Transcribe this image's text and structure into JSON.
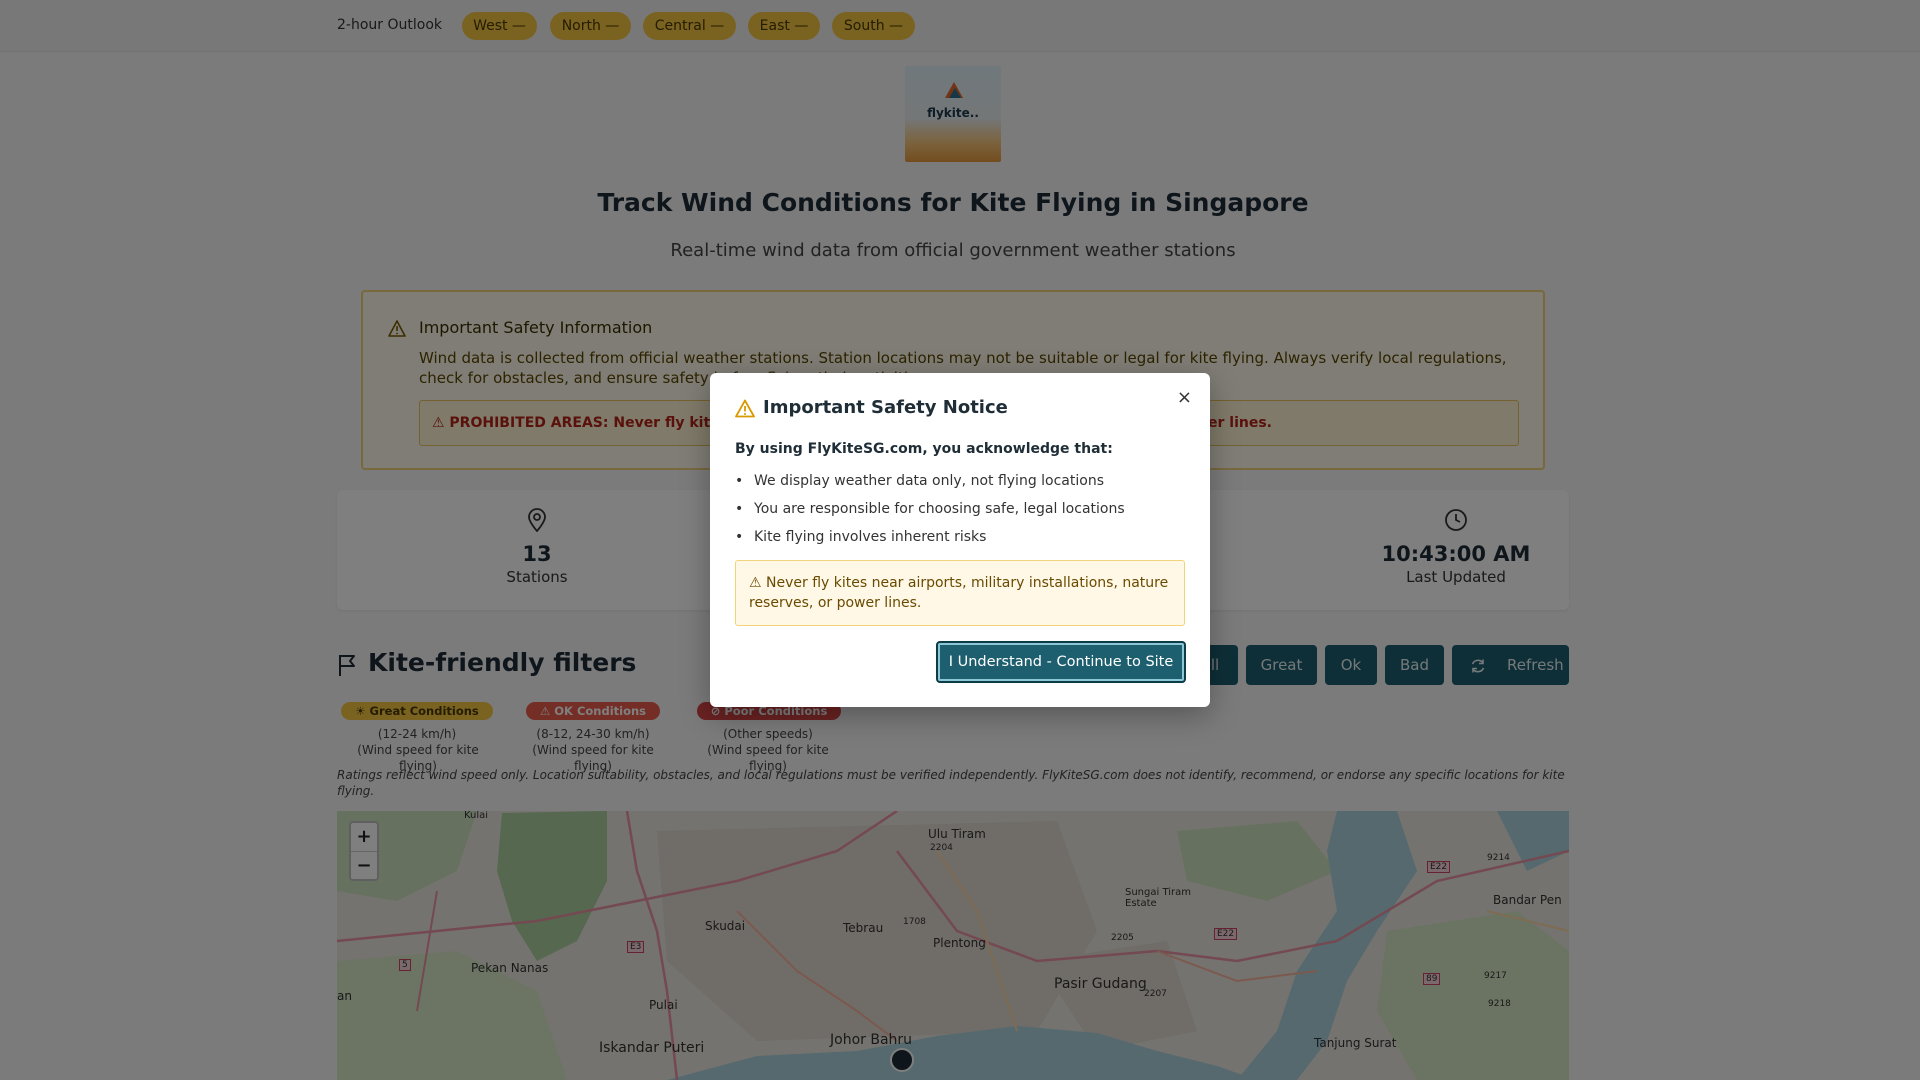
{
  "outlook": {
    "label": "2-hour Outlook",
    "regions": [
      "West —",
      "North —",
      "Central —",
      "East —",
      "South —"
    ]
  },
  "logo": {
    "brand": "flykite.."
  },
  "hero": {
    "title": "Track Wind Conditions for Kite Flying in Singapore",
    "subtitle": "Real-time wind data from official government weather stations"
  },
  "safety_info": {
    "title": "Important Safety Information",
    "body": "Wind data is collected from official weather stations. Station locations may not be suitable or legal for kite flying. Always verify local regulations, check for obstacles, and ensure safety before flying.",
    "body_tail": "their activities.",
    "prohibited": "⚠ PROHIBITED AREAS: Never fly kit",
    "prohibited_tail": "er lines."
  },
  "stats": {
    "stations": {
      "value": "13",
      "caption": "Stations"
    },
    "updated": {
      "value": "10:43:00 AM",
      "caption": "Last Updated"
    }
  },
  "filters": {
    "title": "Kite-friendly filters",
    "buttons": {
      "all": "ll",
      "great": "Great",
      "ok": "Ok",
      "bad": "Bad",
      "refresh": "Refresh"
    },
    "legend": [
      {
        "badge": "☀ Great Conditions",
        "range": "(12-24 km/h)",
        "desc": "(Wind speed for kite flying)"
      },
      {
        "badge": "⚠ OK Conditions",
        "range": "(8-12, 24-30 km/h)",
        "desc": "(Wind speed for kite flying)"
      },
      {
        "badge": "⊘ Poor Conditions",
        "range": "(Other speeds)",
        "desc": "(Wind speed for kite flying)"
      }
    ],
    "note": "Ratings reflect wind speed only. Location suitability, obstacles, and local regulations must be verified independently. FlyKiteSG.com does not identify, recommend, or endorse any specific locations for kite flying."
  },
  "map": {
    "zoom_in": "+",
    "zoom_out": "−",
    "labels": {
      "kulai": "Kulai",
      "ulu_tiram": "Ulu Tiram",
      "sungai_tiram": "Sungai Tiram Estate",
      "bandar_pen": "Bandar Pen",
      "skudai": "Skudai",
      "tebrau": "Tebrau",
      "plentong": "Plentong",
      "pekan_nanas": "Pekan Nanas",
      "pasir_gudang": "Pasir Gudang",
      "pulai": "Pulai",
      "iskandar_puteri": "Iskandar Puteri",
      "johor_bahru": "Johor Bahru",
      "tanjung_surat": "Tanjung Surat",
      "an": "an"
    },
    "road_labels": {
      "e22a": "E22",
      "e22b": "E22",
      "e3": "E3",
      "r5": "5",
      "r89": "89",
      "r9214": "9214",
      "r9217": "9217",
      "r9218": "9218",
      "r2204": "2204",
      "r1708": "1708",
      "r2205": "2205",
      "r2207": "2207"
    }
  },
  "modal": {
    "title": "Important Safety Notice",
    "close": "×",
    "lead": "By using FlyKiteSG.com, you acknowledge that:",
    "points": [
      "We display weather data only, not flying locations",
      "You are responsible for choosing safe, legal locations",
      "Kite flying involves inherent risks"
    ],
    "alert": "⚠ Never fly kites near airports, military installations, nature reserves, or power lines.",
    "confirm": "I Understand - Continue to Site"
  },
  "colors": {
    "primary": "#1d5f6f",
    "pill": "#f4c542",
    "great": "#f4c542",
    "ok": "#e85d4a",
    "poor": "#d64545"
  }
}
